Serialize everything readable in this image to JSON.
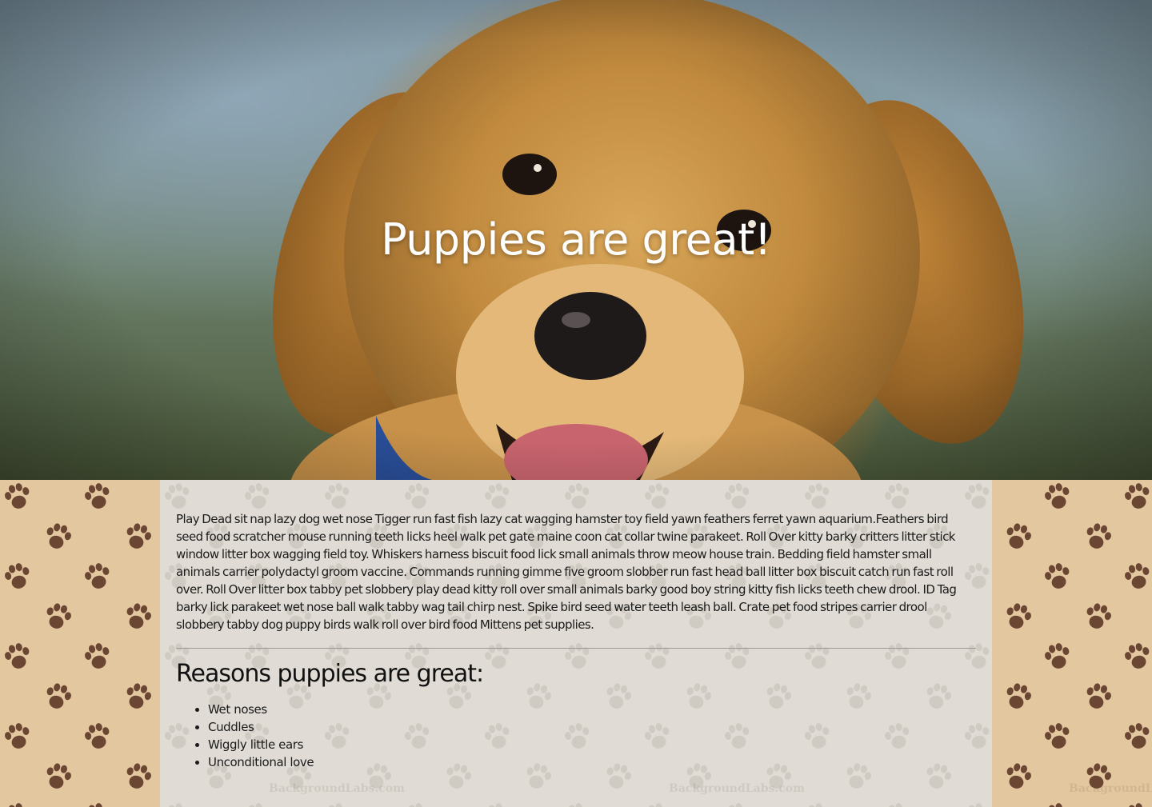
{
  "hero": {
    "title": "Puppies are great!"
  },
  "content": {
    "paragraph": "Play Dead sit nap lazy dog wet nose Tigger run fast fish lazy cat wagging hamster toy field yawn feathers ferret yawn aquarium.Feathers bird seed food scratcher mouse running teeth licks heel walk pet gate maine coon cat collar twine parakeet. Roll Over kitty barky critters litter stick window litter box wagging field toy. Whiskers harness biscuit food lick small animals throw meow house train. Bedding field hamster small animals carrier polydactyl groom vaccine. Commands running gimme five groom slobber run fast head ball litter box biscuit catch run fast roll over. Roll Over litter box tabby pet slobbery play dead kitty roll over small animals barky good boy string kitty fish licks teeth chew drool. ID Tag barky lick parakeet wet nose ball walk tabby wag tail chirp nest. Spike bird seed water teeth leash ball. Crate pet food stripes carrier drool slobbery tabby dog puppy birds walk roll over bird food Mittens pet supplies.",
    "reasons_heading": "Reasons puppies are great:",
    "reasons": [
      "Wet noses",
      "Cuddles",
      "Wiggly little ears",
      "Unconditional love"
    ]
  },
  "watermark": "BackgroundLabs.com",
  "colors": {
    "side_panel": "#e2c79f",
    "center_panel": "#e0dcd5",
    "paw_dark": "#6b4632",
    "paw_light": "#cfcac2",
    "hero_title": "#ffffff"
  },
  "icons": {
    "paw": "paw-print-icon"
  }
}
